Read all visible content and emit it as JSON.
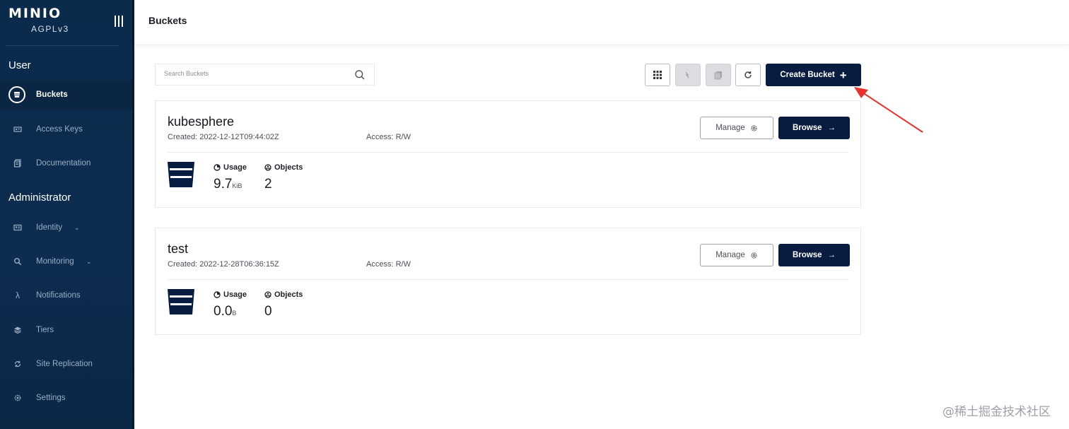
{
  "brand": {
    "logo": "MINIO",
    "edition": "AGPLv3"
  },
  "sidebar": {
    "user_section": "User",
    "admin_section": "Administrator",
    "user_items": [
      {
        "label": "Buckets",
        "icon": "bucket-icon"
      },
      {
        "label": "Access Keys",
        "icon": "key-icon"
      },
      {
        "label": "Documentation",
        "icon": "document-icon"
      }
    ],
    "admin_items": [
      {
        "label": "Identity",
        "icon": "identity-icon"
      },
      {
        "label": "Monitoring",
        "icon": "monitoring-icon"
      },
      {
        "label": "Notifications",
        "icon": "lambda-icon"
      },
      {
        "label": "Tiers",
        "icon": "tiers-icon"
      },
      {
        "label": "Site Replication",
        "icon": "replication-icon"
      },
      {
        "label": "Settings",
        "icon": "gear-icon"
      }
    ]
  },
  "header": {
    "title": "Buckets"
  },
  "search": {
    "placeholder": "Search Buckets"
  },
  "toolbar": {
    "create_label": "Create Bucket"
  },
  "buckets": [
    {
      "name": "kubesphere",
      "created": "Created: 2022-12-12T09:44:02Z",
      "access": "Access: R/W",
      "manage_label": "Manage",
      "browse_label": "Browse",
      "usage_label": "Usage",
      "usage_value": "9.7",
      "usage_unit": "KiB",
      "objects_label": "Objects",
      "objects_value": "2"
    },
    {
      "name": "test",
      "created": "Created: 2022-12-28T06:36:15Z",
      "access": "Access: R/W",
      "manage_label": "Manage",
      "browse_label": "Browse",
      "usage_label": "Usage",
      "usage_value": "0.0",
      "usage_unit": "B",
      "objects_label": "Objects",
      "objects_value": "0"
    }
  ],
  "watermark": "@稀土掘金技术社区",
  "colors": {
    "sidebar": "#0b2b4d",
    "primary": "#081c42",
    "annotation": "#e8322b"
  }
}
